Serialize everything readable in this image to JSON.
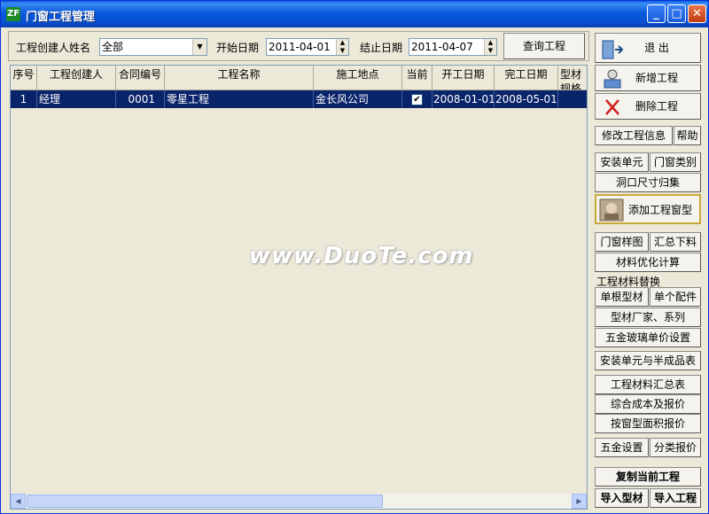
{
  "window": {
    "title": "门窗工程管理",
    "app_icon_text": "ZF",
    "minimize_glyph": "_",
    "maximize_glyph": "□",
    "close_glyph": "✕"
  },
  "filter": {
    "creator_label": "工程创建人姓名",
    "creator_value": "全部",
    "start_label": "开始日期",
    "start_value": "2011-04-01",
    "end_label": "结止日期",
    "end_value": "2011-04-07",
    "query_button": "查询工程"
  },
  "grid": {
    "columns": [
      "序号",
      "工程创建人",
      "合同编号",
      "工程名称",
      "施工地点",
      "当前",
      "开工日期",
      "完工日期",
      "型材规格(元"
    ],
    "rows": [
      {
        "index": "1",
        "creator": "经理",
        "contract": "0001",
        "name": "零星工程",
        "location": "金长风公司",
        "current": "✔",
        "start": "2008-01-01",
        "end": "2008-05-01"
      }
    ]
  },
  "sidebar": {
    "exit": "退 出",
    "new_project": "新增工程",
    "delete_project": "删除工程",
    "edit_info": "修改工程信息",
    "help": "帮助",
    "install_unit": "安装单元",
    "window_category": "门窗类别",
    "opening_size": "洞口尺寸归集",
    "add_window_type": "添加工程窗型",
    "window_drawing": "门窗样图",
    "summary_cut": "汇总下料",
    "material_optimize": "材料优化计算",
    "material_replace_caption": "工程材料替换",
    "single_profile": "单根型材",
    "single_part": "单个配件",
    "profile_vendor": "型材厂家、系列",
    "hardware_glass_price": "五金玻璃单价设置",
    "unit_semi_table": "安装单元与半成品表",
    "material_summary": "工程材料汇总表",
    "cost_quote": "综合成本及报价",
    "area_quote": "按窗型面积报价",
    "hardware_settings": "五金设置",
    "category_quote": "分类报价",
    "copy_project": "复制当前工程",
    "import_profile": "导入型材",
    "import_project": "导入工程"
  },
  "watermark": "www.DuoTe.com",
  "icons": {
    "exit": "exit-door-icon",
    "new": "new-project-icon",
    "delete": "delete-x-icon",
    "add_window": "window-type-icon"
  },
  "colors": {
    "titlebar": "#0a58dc",
    "selection": "#0a246a",
    "face": "#ece9d8"
  }
}
